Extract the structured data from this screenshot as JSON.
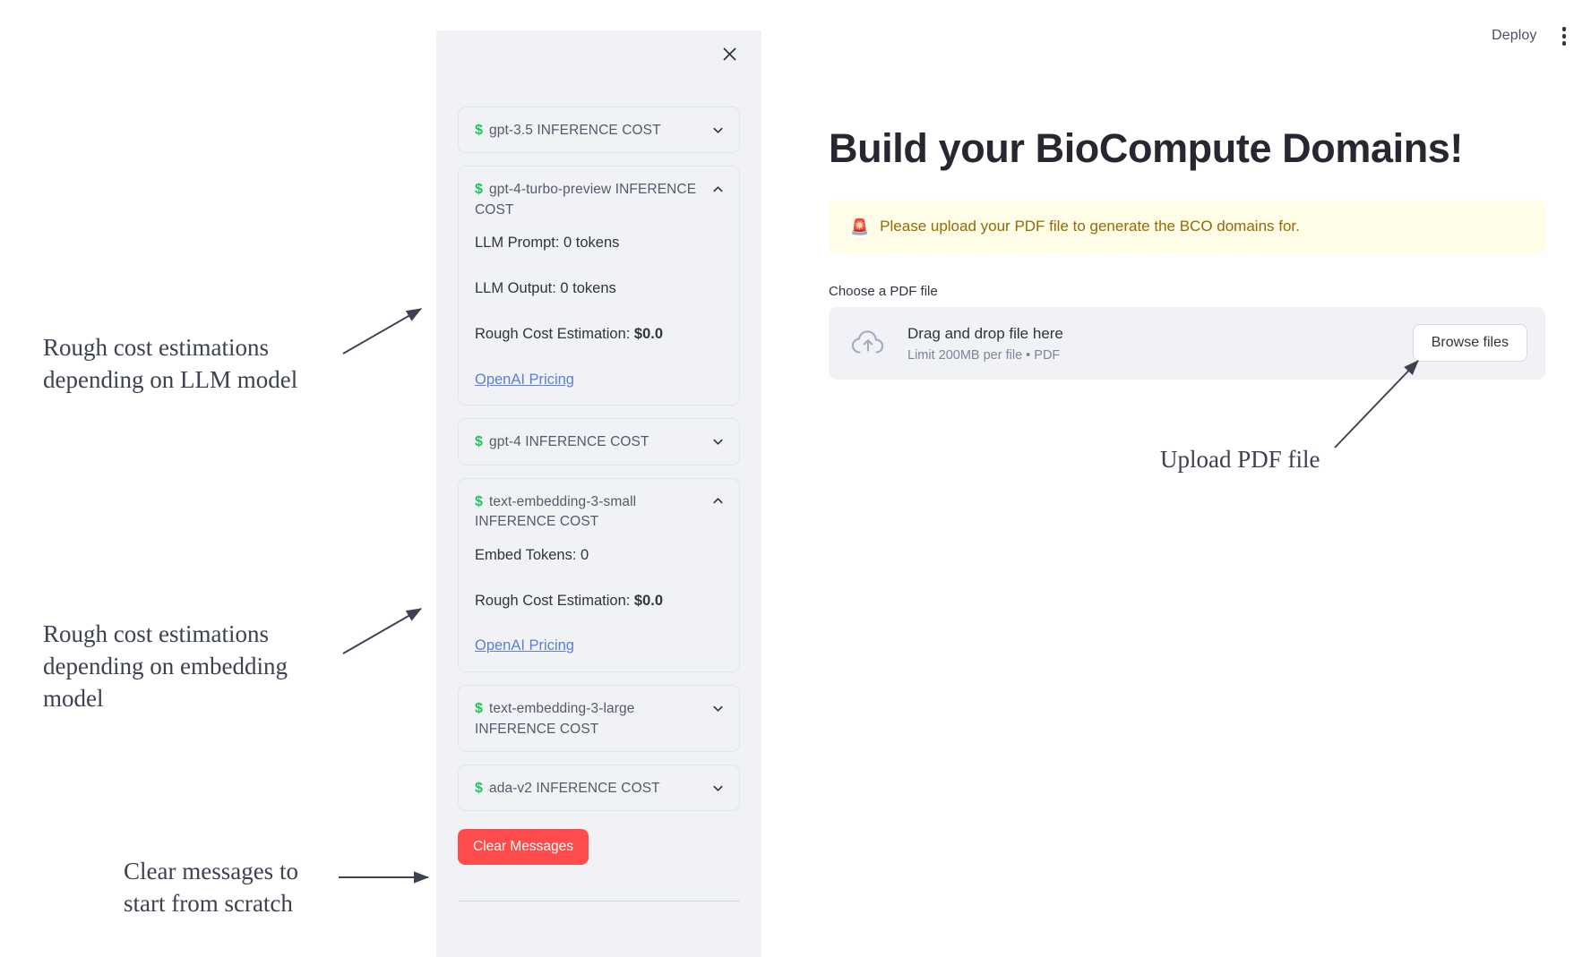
{
  "toolbar": {
    "deploy_label": "Deploy",
    "menu_icon": "vertical-dots-icon"
  },
  "sidebar": {
    "close_icon": "close-icon",
    "money_icon": "dollar-icon",
    "expanders": [
      {
        "title": "gpt-3.5 INFERENCE COST",
        "expanded": false,
        "chevron": "chevron-down-icon",
        "lines": []
      },
      {
        "title": "gpt-4-turbo-preview INFERENCE COST",
        "expanded": true,
        "chevron": "chevron-up-icon",
        "lines": [
          {
            "label": "LLM Prompt: 0 tokens",
            "value": ""
          },
          {
            "label": "LLM Output: 0 tokens",
            "value": ""
          },
          {
            "label": "Rough Cost Estimation: ",
            "value": "$0.0"
          }
        ],
        "link": "OpenAI Pricing"
      },
      {
        "title": "gpt-4 INFERENCE COST",
        "expanded": false,
        "chevron": "chevron-down-icon",
        "lines": []
      },
      {
        "title": "text-embedding-3-small INFERENCE COST",
        "expanded": true,
        "chevron": "chevron-up-icon",
        "lines": [
          {
            "label": "Embed Tokens: 0",
            "value": ""
          },
          {
            "label": "Rough Cost Estimation: ",
            "value": "$0.0"
          }
        ],
        "link": "OpenAI Pricing"
      },
      {
        "title": "text-embedding-3-large INFERENCE COST",
        "expanded": false,
        "chevron": "chevron-down-icon",
        "lines": []
      },
      {
        "title": "ada-v2 INFERENCE COST",
        "expanded": false,
        "chevron": "chevron-down-icon",
        "lines": []
      }
    ],
    "clear_button_label": "Clear Messages",
    "clear_button_color": "#ff4b4b"
  },
  "main": {
    "title": "Build your BioCompute Domains!",
    "warning": {
      "icon": "🚨",
      "text": "Please upload your PDF file to generate the BCO domains for.",
      "background": "#fffce7",
      "text_color": "#926c05"
    },
    "uploader": {
      "label": "Choose a PDF file",
      "icon": "cloud-upload-icon",
      "drop_text": "Drag and drop file here",
      "limit_text": "Limit 200MB per file • PDF",
      "browse_label": "Browse files"
    }
  },
  "annotations": {
    "llm_cost": "Rough cost estimations depending on LLM model",
    "embedding_cost": "Rough cost estimations depending on embedding model",
    "clear_messages": "Clear messages to start from scratch",
    "upload_pdf": "Upload PDF file"
  }
}
